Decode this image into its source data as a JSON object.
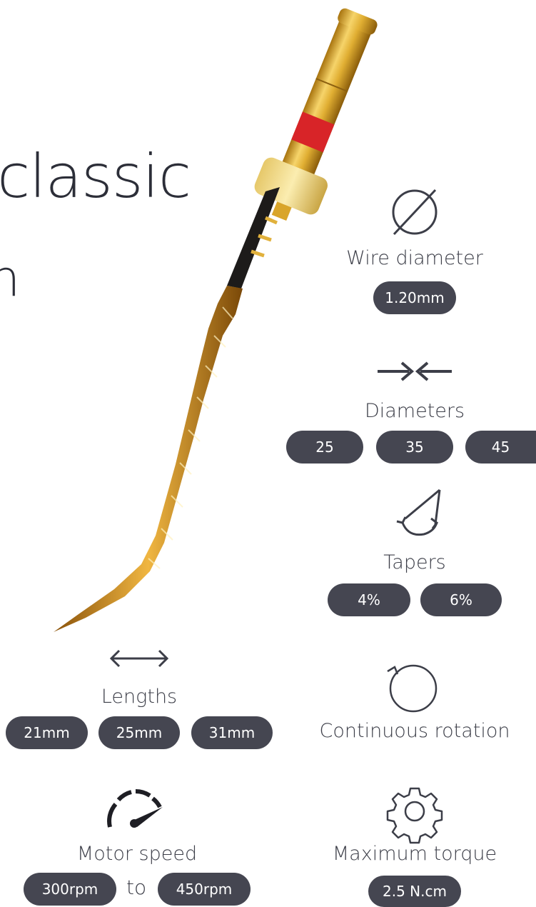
{
  "heading": {
    "line1": "classic",
    "line2": "n"
  },
  "specs": {
    "wire_diameter": {
      "label": "Wire diameter",
      "value": "1.20mm",
      "icon": "diameter-icon"
    },
    "diameters": {
      "label": "Diameters",
      "values": [
        "25",
        "35",
        "45"
      ],
      "icon": "diameters-arrows-icon"
    },
    "tapers": {
      "label": "Tapers",
      "values": [
        "4%",
        "6%"
      ],
      "icon": "taper-icon"
    },
    "rotation": {
      "label": "Continuous rotation",
      "icon": "rotation-icon"
    },
    "lengths": {
      "label": "Lengths",
      "values": [
        "21mm",
        "25mm",
        "31mm"
      ],
      "icon": "double-arrow-icon"
    },
    "torque": {
      "label": "Maximum torque",
      "value": "2.5 N.cm",
      "icon": "gear-icon"
    },
    "motor_speed": {
      "label": "Motor speed",
      "min": "300rpm",
      "joiner": "to",
      "max": "450rpm",
      "icon": "speedometer-icon"
    }
  },
  "colors": {
    "pill_bg": "#454651",
    "text": "#3c3e48",
    "file_gold": "#d9a52a",
    "file_band_red": "#e0262a"
  }
}
